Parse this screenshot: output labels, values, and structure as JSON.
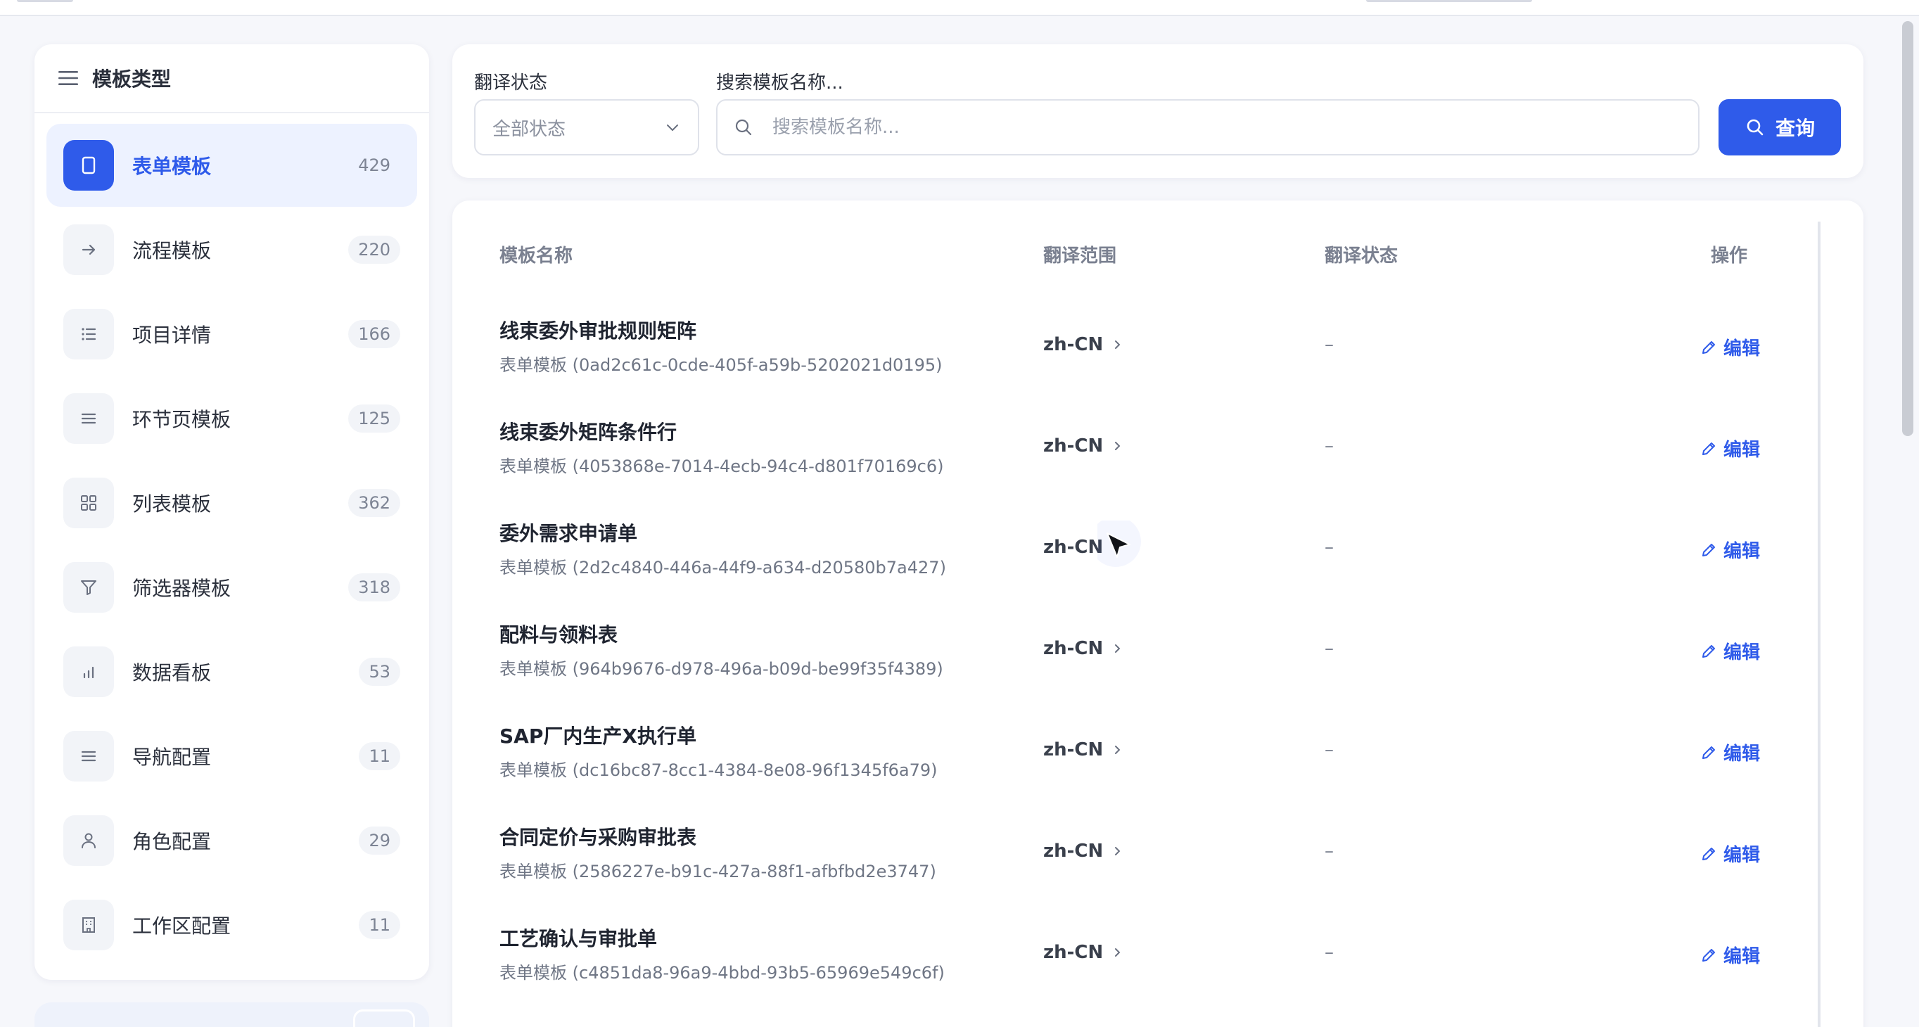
{
  "sidebar": {
    "title": "模板类型",
    "items": [
      {
        "label": "表单模板",
        "count": "429",
        "icon": "form-icon"
      },
      {
        "label": "流程模板",
        "count": "220",
        "icon": "arrow-right-icon"
      },
      {
        "label": "项目详情",
        "count": "166",
        "icon": "list-bullet-icon"
      },
      {
        "label": "环节页模板",
        "count": "125",
        "icon": "menu-lines-icon"
      },
      {
        "label": "列表模板",
        "count": "362",
        "icon": "grid-icon"
      },
      {
        "label": "筛选器模板",
        "count": "318",
        "icon": "filter-icon"
      },
      {
        "label": "数据看板",
        "count": "53",
        "icon": "bar-chart-icon"
      },
      {
        "label": "导航配置",
        "count": "11",
        "icon": "menu-lines-icon"
      },
      {
        "label": "角色配置",
        "count": "29",
        "icon": "user-icon"
      },
      {
        "label": "工作区配置",
        "count": "11",
        "icon": "building-icon"
      }
    ]
  },
  "filters": {
    "status_label": "翻译状态",
    "status_value": "全部状态",
    "search_label": "搜索模板名称...",
    "search_placeholder": "搜索模板名称...",
    "query_button": "查询"
  },
  "table": {
    "columns": {
      "name": "模板名称",
      "scope": "翻译范围",
      "status": "翻译状态",
      "action": "操作"
    },
    "rows": [
      {
        "name": "线束委外审批规则矩阵",
        "sub": "表单模板 (0ad2c61c-0cde-405f-a59b-5202021d0195)",
        "scope": "zh-CN",
        "status": "–",
        "action": "编辑"
      },
      {
        "name": "线束委外矩阵条件行",
        "sub": "表单模板 (4053868e-7014-4ecb-94c4-d801f70169c6)",
        "scope": "zh-CN",
        "status": "–",
        "action": "编辑"
      },
      {
        "name": "委外需求申请单",
        "sub": "表单模板 (2d2c4840-446a-44f9-a634-d20580b7a427)",
        "scope": "zh-CN",
        "status": "–",
        "action": "编辑"
      },
      {
        "name": "配料与领料表",
        "sub": "表单模板 (964b9676-d978-496a-b09d-be99f35f4389)",
        "scope": "zh-CN",
        "status": "–",
        "action": "编辑"
      },
      {
        "name": "SAP厂内生产X执行单",
        "sub": "表单模板 (dc16bc87-8cc1-4384-8e08-96f1345f6a79)",
        "scope": "zh-CN",
        "status": "–",
        "action": "编辑"
      },
      {
        "name": "合同定价与采购审批表",
        "sub": "表单模板 (2586227e-b91c-427a-88f1-afbfbd2e3747)",
        "scope": "zh-CN",
        "status": "–",
        "action": "编辑"
      },
      {
        "name": "工艺确认与审批单",
        "sub": "表单模板 (c4851da8-96a9-4bbd-93b5-65969e549c6f)",
        "scope": "zh-CN",
        "status": "–",
        "action": "编辑"
      }
    ]
  },
  "colors": {
    "accent": "#2f5bea",
    "active_bg": "#edf2ff"
  }
}
